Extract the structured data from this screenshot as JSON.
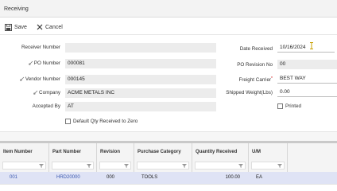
{
  "window": {
    "title": "Receiving"
  },
  "toolbar": {
    "save_label": "Save",
    "cancel_label": "Cancel"
  },
  "form": {
    "receiver_number": {
      "label": "Receiver Number",
      "value": ""
    },
    "po_number": {
      "label": "PO Number",
      "value": "000081"
    },
    "vendor_number": {
      "label": "Vendor Number",
      "value": "000145"
    },
    "company": {
      "label": "Company",
      "value": "ACME METALS INC"
    },
    "accepted_by": {
      "label": "Accepted By",
      "value": "AT"
    },
    "default_qty": {
      "label": "Default Qty Received to Zero",
      "checked": false
    },
    "date_received": {
      "label": "Date Received",
      "value": "10/16/2024"
    },
    "po_revision_no": {
      "label": "PO Revision No",
      "value": "00"
    },
    "freight_carrier": {
      "label": "Freight Carrier",
      "value": "BEST WAY",
      "required_marker": "*"
    },
    "shipped_weight": {
      "label": "Shipped Weight(Lbs)",
      "value": "0.00"
    },
    "printed": {
      "label": "Printed",
      "checked": false
    }
  },
  "grid": {
    "columns": [
      "Item Number",
      "Part Number",
      "Revision",
      "Purchase Category",
      "Quantity Received",
      "U/M"
    ],
    "rows": [
      {
        "item_number": "001",
        "part_number": "HRD20000",
        "revision": "000",
        "purchase_category": "TOOLS",
        "quantity_received": "100.00",
        "um": "EA"
      }
    ]
  }
}
